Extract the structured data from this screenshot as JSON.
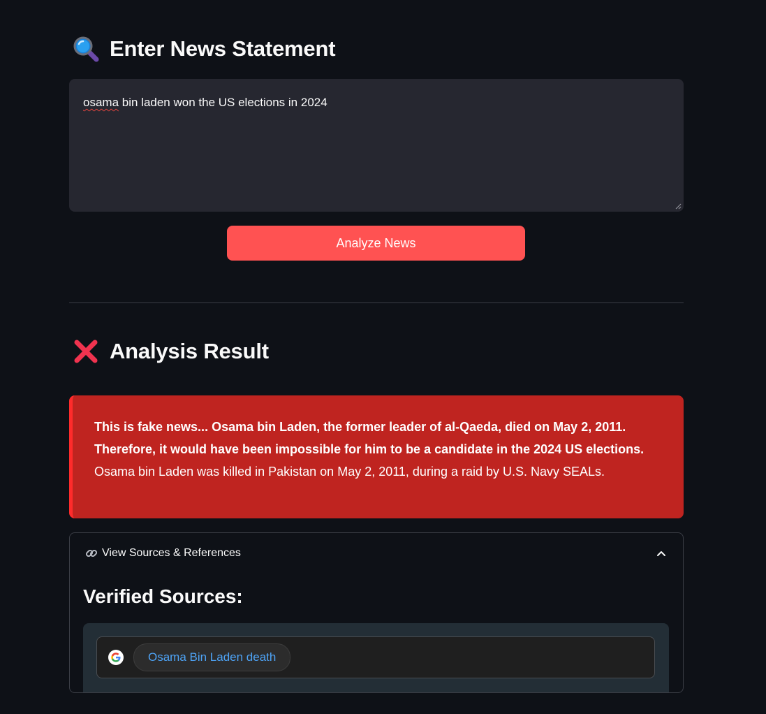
{
  "input_section": {
    "heading": "Enter News Statement",
    "heading_icon": "magnifying-glass-icon",
    "textarea": {
      "value_first_word": "osama",
      "value_rest": " bin laden won the US elections in 2024"
    },
    "analyze_button_label": "Analyze News"
  },
  "result_section": {
    "heading": "Analysis Result",
    "heading_icon": "red-cross-icon",
    "alert": {
      "bold_text": "This is fake news... Osama bin Laden, the former leader of al-Qaeda, died on May 2, 2011. Therefore, it would have been impossible for him to be a candidate in the 2024 US elections.",
      "normal_text": "Osama bin Laden was killed in Pakistan on May 2, 2011, during a raid by U.S. Navy SEALs.",
      "color": "#bf2420"
    }
  },
  "sources": {
    "expander_label": "View Sources & References",
    "expander_icon": "link-icon",
    "expanded": true,
    "title": "Verified Sources:",
    "google_chip_label": "Osama Bin Laden death"
  },
  "colors": {
    "background": "#0e1117",
    "button": "#ff5252",
    "link": "#4ea3f5"
  }
}
